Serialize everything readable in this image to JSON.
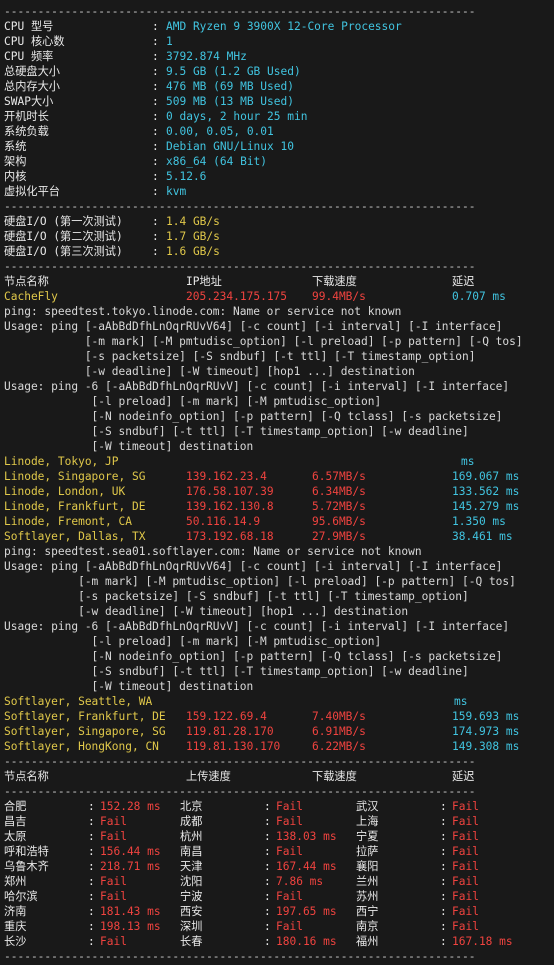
{
  "sep": "----------------------------------------------------------------------",
  "sysinfo": [
    {
      "k": "CPU 型号",
      "v": "AMD Ryzen 9 3900X 12-Core Processor"
    },
    {
      "k": "CPU 核心数",
      "v": "1"
    },
    {
      "k": "CPU 频率",
      "v": "3792.874 MHz"
    },
    {
      "k": "总硬盘大小",
      "v": "9.5 GB (1.2 GB Used)"
    },
    {
      "k": "总内存大小",
      "v": "476 MB (69 MB Used)"
    },
    {
      "k": "SWAP大小",
      "v": "509 MB (13 MB Used)"
    },
    {
      "k": "开机时长",
      "v": "0 days, 2 hour 25 min"
    },
    {
      "k": "系统负载",
      "v": "0.00, 0.05, 0.01"
    },
    {
      "k": "系统",
      "v": "Debian GNU/Linux 10"
    },
    {
      "k": "架构",
      "v": "x86_64 (64 Bit)"
    },
    {
      "k": "内核",
      "v": "5.12.6"
    },
    {
      "k": "虚拟化平台",
      "v": "kvm"
    }
  ],
  "io": [
    {
      "k": "硬盘I/O (第一次测试)",
      "v": "1.4 GB/s"
    },
    {
      "k": "硬盘I/O (第二次测试)",
      "v": "1.7 GB/s"
    },
    {
      "k": "硬盘I/O (第三次测试)",
      "v": "1.6 GB/s"
    }
  ],
  "speed_header": {
    "node": "节点名称",
    "ip": "IP地址",
    "dl": "下载速度",
    "lat": "延迟"
  },
  "cachefly": {
    "node": "CacheFly",
    "ip": "205.234.175.175",
    "dl": "99.4MB/s",
    "lat": "0.707 ms"
  },
  "ping_err1": "ping: speedtest.tokyo.linode.com: Name or service not known",
  "usage1": [
    "Usage: ping [-aAbBdDfhLnOqrRUvV64] [-c count] [-i interval] [-I interface]",
    "            [-m mark] [-M pmtudisc_option] [-l preload] [-p pattern] [-Q tos]",
    "            [-s packetsize] [-S sndbuf] [-t ttl] [-T timestamp_option]",
    "            [-w deadline] [-W timeout] [hop1 ...] destination",
    "Usage: ping -6 [-aAbBdDfhLnOqrRUvV] [-c count] [-i interval] [-I interface]",
    "             [-l preload] [-m mark] [-M pmtudisc_option]",
    "             [-N nodeinfo_option] [-p pattern] [-Q tclass] [-s packetsize]",
    "             [-S sndbuf] [-t ttl] [-T timestamp_option] [-w deadline]",
    "             [-W timeout] destination"
  ],
  "linode": [
    {
      "node": "Linode, Tokyo, JP",
      "ip": "",
      "dl": "",
      "lat": "ms"
    },
    {
      "node": "Linode, Singapore, SG",
      "ip": "139.162.23.4",
      "dl": "6.57MB/s",
      "lat": "169.067 ms"
    },
    {
      "node": "Linode, London, UK",
      "ip": "176.58.107.39",
      "dl": "6.34MB/s",
      "lat": "133.562 ms"
    },
    {
      "node": "Linode, Frankfurt, DE",
      "ip": "139.162.130.8",
      "dl": "5.72MB/s",
      "lat": "145.279 ms"
    },
    {
      "node": "Linode, Fremont, CA",
      "ip": "50.116.14.9",
      "dl": "95.6MB/s",
      "lat": "1.350 ms"
    },
    {
      "node": "Softlayer, Dallas, TX",
      "ip": "173.192.68.18",
      "dl": "27.9MB/s",
      "lat": "38.461 ms"
    }
  ],
  "ping_err2": "ping: speedtest.sea01.softlayer.com: Name or service not known",
  "usage2": [
    "Usage: ping [-aAbBdDfhLnOqrRUvV64] [-c count] [-i interval] [-I interface]",
    "           [-m mark] [-M pmtudisc_option] [-l preload] [-p pattern] [-Q tos]",
    "           [-s packetsize] [-S sndbuf] [-t ttl] [-T timestamp_option]",
    "           [-w deadline] [-W timeout] [hop1 ...] destination",
    "Usage: ping -6 [-aAbBdDfhLnOqrRUvV] [-c count] [-i interval] [-I interface]",
    "             [-l preload] [-m mark] [-M pmtudisc_option]",
    "             [-N nodeinfo_option] [-p pattern] [-Q tclass] [-s packetsize]",
    "             [-S sndbuf] [-t ttl] [-T timestamp_option] [-w deadline]",
    "             [-W timeout] destination"
  ],
  "softlayer": [
    {
      "node": "Softlayer, Seattle, WA",
      "ip": "",
      "dl": "",
      "lat": "ms"
    },
    {
      "node": "Softlayer, Frankfurt, DE",
      "ip": "159.122.69.4",
      "dl": "7.40MB/s",
      "lat": "159.693 ms"
    },
    {
      "node": "Softlayer, Singapore, SG",
      "ip": "119.81.28.170",
      "dl": "6.91MB/s",
      "lat": "174.973 ms"
    },
    {
      "node": "Softlayer, HongKong, CN",
      "ip": "119.81.130.170",
      "dl": "6.22MB/s",
      "lat": "149.308 ms"
    }
  ],
  "cn_header": {
    "node": "节点名称",
    "up": "上传速度",
    "dl": "下载速度",
    "lat": "延迟"
  },
  "cn_rows": [
    [
      [
        "合肥",
        "152.28 ms"
      ],
      [
        "北京",
        "Fail"
      ],
      [
        "武汉",
        "Fail"
      ]
    ],
    [
      [
        "昌吉",
        "Fail"
      ],
      [
        "成都",
        "Fail"
      ],
      [
        "上海",
        "Fail"
      ]
    ],
    [
      [
        "太原",
        "Fail"
      ],
      [
        "杭州",
        "138.03 ms"
      ],
      [
        "宁夏",
        "Fail"
      ]
    ],
    [
      [
        "呼和浩特",
        "156.44 ms"
      ],
      [
        "南昌",
        "Fail"
      ],
      [
        "拉萨",
        "Fail"
      ]
    ],
    [
      [
        "乌鲁木齐",
        "218.71 ms"
      ],
      [
        "天津",
        "167.44 ms"
      ],
      [
        "襄阳",
        "Fail"
      ]
    ],
    [
      [
        "郑州",
        "Fail"
      ],
      [
        "沈阳",
        "7.86 ms"
      ],
      [
        "兰州",
        "Fail"
      ]
    ],
    [
      [
        "哈尔滨",
        "Fail"
      ],
      [
        "宁波",
        "Fail"
      ],
      [
        "苏州",
        "Fail"
      ]
    ],
    [
      [
        "济南",
        "181.43 ms"
      ],
      [
        "西安",
        "197.65 ms"
      ],
      [
        "西宁",
        "Fail"
      ]
    ],
    [
      [
        "重庆",
        "198.13 ms"
      ],
      [
        "深圳",
        "Fail"
      ],
      [
        "南京",
        "Fail"
      ]
    ],
    [
      [
        "长沙",
        "Fail"
      ],
      [
        "长春",
        "180.16 ms"
      ],
      [
        "福州",
        "167.18 ms"
      ]
    ]
  ],
  "colors": {
    "cyan": "#41c4e0",
    "yellow": "#e0c84a",
    "red": "#f0433f",
    "bg": "#191919"
  }
}
